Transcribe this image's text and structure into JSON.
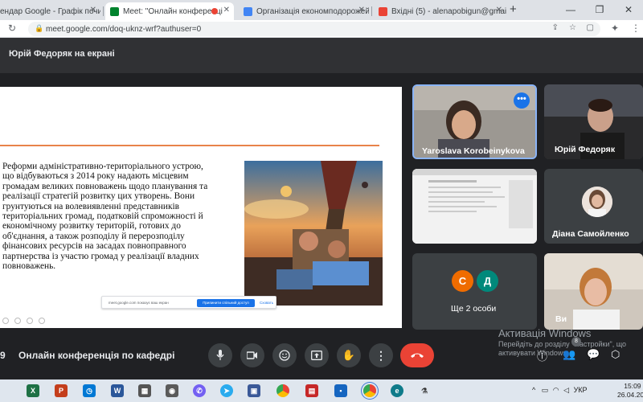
{
  "browser": {
    "tabs": [
      {
        "title": "ендар Google - Графік почин",
        "active": false,
        "favicon_color": "#4285f4"
      },
      {
        "title": "Meet: \"Онлайн конференці",
        "active": true,
        "favicon_color": "#00832d"
      },
      {
        "title": "Організація економподорожей",
        "active": false,
        "favicon_color": "#4285f4"
      },
      {
        "title": "Вхідні (5) - alenapobigun@gmail",
        "active": false,
        "favicon_color": "#ea4335"
      }
    ],
    "new_tab_label": "+",
    "url": "meet.google.com/doq-uknz-wrf?authuser=0"
  },
  "meet": {
    "presenter_label": "Юрій Федоряк на екрані",
    "slide": {
      "text": "  Реформи адміністративно-територіального устрою,\nщо відбуваються з 2014 року надають місцевим\nгромадам великих повноважень щодо планування та\nреалізації стратегій розвитку цих утворень. Вони\nгрунтуються на волевиявленні представників\nтериторіальних громад, податковій спроможності й\nекономічному розвитку територій, готових до\nоб'єднання, а також розподілу й перерозподілу\nфінансових ресурсів на засадах повноправного\nпартнерства із участю громад у реалізації владних\nповноважень.",
      "share_notice": {
        "text": "meet.google.com показує ваш екран",
        "stop_button": "Припинити спільний доступ",
        "hide_link": "Сховать"
      }
    },
    "participants": [
      {
        "name": "Yaroslava Korobeinykova"
      },
      {
        "name": "Юрій Федоряк"
      },
      {
        "name": "Діана Самойленко"
      },
      {
        "name": "Ще 2 особи",
        "initials": [
          "С",
          "Д"
        ]
      },
      {
        "name": "Ви"
      }
    ],
    "activation": {
      "line1": "Активація Windows",
      "line2": "Перейдіть до розділу \"Настройки\", що",
      "line3": "активувати Windows."
    },
    "meeting_time": "9",
    "meeting_title": "Онлайн конференція по кафедрі",
    "people_count": "8"
  },
  "taskbar": {
    "language": "УКР",
    "time": "15:09",
    "date": "26.04.202"
  },
  "colors": {
    "accent_blue": "#1a73e8",
    "leave_red": "#ea4335",
    "slide_line": "#e8834a",
    "meet_bg": "#202124"
  }
}
